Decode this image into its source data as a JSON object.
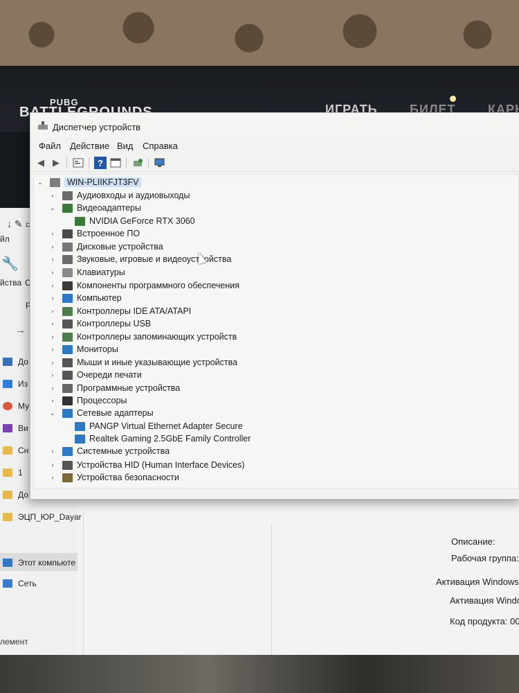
{
  "game": {
    "logo_small": "PUBG",
    "logo": "BATTLEGROUNDS",
    "nav": [
      "ИГРАТЬ",
      "БИЛЕТ",
      "КАРЬ"
    ]
  },
  "explorer": {
    "sidebar": [
      {
        "label": "До",
        "icon": "documents-icon"
      },
      {
        "label": "Из",
        "icon": "pictures-icon"
      },
      {
        "label": "Му",
        "icon": "music-icon"
      },
      {
        "label": "Ви",
        "icon": "videos-icon"
      },
      {
        "label": "Сн",
        "icon": "folder-icon"
      },
      {
        "label": "1",
        "icon": "folder-icon"
      },
      {
        "label": "До",
        "icon": "folder-icon"
      },
      {
        "label": "ЭЦП_ЮР_Dayar",
        "icon": "folder-icon"
      },
      {
        "label": "Этот компьюте",
        "icon": "this-pc-icon"
      },
      {
        "label": "Сеть",
        "icon": "network-icon"
      }
    ],
    "left_fragments": [
      "йл",
      "йства",
      "О",
      "Р"
    ],
    "status": "лемент",
    "info_labels": [
      "Описание:",
      "Рабочая группа:",
      "Активация Windows",
      "Активация Windo",
      "Код продукта: 00"
    ]
  },
  "devmgr": {
    "title": "Диспетчер устройств",
    "menu": [
      "Файл",
      "Действие",
      "Вид",
      "Справка"
    ],
    "toolbar_icons": [
      "back-arrow-icon",
      "forward-arrow-icon",
      "properties-icon",
      "help-icon",
      "view-icon",
      "update-driver-icon",
      "scan-hardware-icon"
    ],
    "root": "WIN-PLIIKFJT3FV",
    "tree": [
      {
        "label": "Аудиовходы и аудиовыходы",
        "expanded": false,
        "icon": "speaker-icon",
        "color": "#6b6b6b"
      },
      {
        "label": "Видеоадаптеры",
        "expanded": true,
        "icon": "display-adapter-icon",
        "color": "#3b7a3b",
        "children": [
          {
            "label": "NVIDIA GeForce RTX 3060",
            "icon": "display-adapter-icon",
            "color": "#3b7a3b"
          }
        ]
      },
      {
        "label": "Встроенное ПО",
        "expanded": false,
        "icon": "firmware-icon",
        "color": "#4a4a4a"
      },
      {
        "label": "Дисковые устройства",
        "expanded": false,
        "icon": "disk-icon",
        "color": "#777777"
      },
      {
        "label": "Звуковые, игровые и видеоустройства",
        "expanded": false,
        "icon": "speaker-icon",
        "color": "#6b6b6b"
      },
      {
        "label": "Клавиатуры",
        "expanded": false,
        "icon": "keyboard-icon",
        "color": "#8a8a8a"
      },
      {
        "label": "Компоненты программного обеспечения",
        "expanded": false,
        "icon": "software-component-icon",
        "color": "#3a3a3a"
      },
      {
        "label": "Компьютер",
        "expanded": false,
        "icon": "computer-icon",
        "color": "#2f78c4"
      },
      {
        "label": "Контроллеры IDE ATA/ATAPI",
        "expanded": false,
        "icon": "ide-controller-icon",
        "color": "#4f7d4f"
      },
      {
        "label": "Контроллеры USB",
        "expanded": false,
        "icon": "usb-icon",
        "color": "#555555"
      },
      {
        "label": "Контроллеры запоминающих устройств",
        "expanded": false,
        "icon": "storage-controller-icon",
        "color": "#4f7d4f"
      },
      {
        "label": "Мониторы",
        "expanded": false,
        "icon": "monitor-icon",
        "color": "#2f78c4"
      },
      {
        "label": "Мыши и иные указывающие устройства",
        "expanded": false,
        "icon": "mouse-icon",
        "color": "#555555"
      },
      {
        "label": "Очереди печати",
        "expanded": false,
        "icon": "printer-icon",
        "color": "#555555"
      },
      {
        "label": "Программные устройства",
        "expanded": false,
        "icon": "software-device-icon",
        "color": "#666666"
      },
      {
        "label": "Процессоры",
        "expanded": false,
        "icon": "processor-icon",
        "color": "#333333"
      },
      {
        "label": "Сетевые адаптеры",
        "expanded": true,
        "icon": "network-adapter-icon",
        "color": "#2f78c4",
        "children": [
          {
            "label": "PANGP Virtual Ethernet Adapter Secure",
            "icon": "network-adapter-icon",
            "color": "#2f78c4"
          },
          {
            "label": "Realtek Gaming 2.5GbE Family Controller",
            "icon": "network-adapter-icon",
            "color": "#2f78c4"
          }
        ]
      },
      {
        "label": "Системные устройства",
        "expanded": false,
        "icon": "system-device-icon",
        "color": "#2f78c4"
      },
      {
        "label": "Устройства HID (Human Interface Devices)",
        "expanded": false,
        "icon": "hid-icon",
        "color": "#555555"
      },
      {
        "label": "Устройства безопасности",
        "expanded": false,
        "icon": "security-device-icon",
        "color": "#7a6a3a"
      }
    ]
  }
}
